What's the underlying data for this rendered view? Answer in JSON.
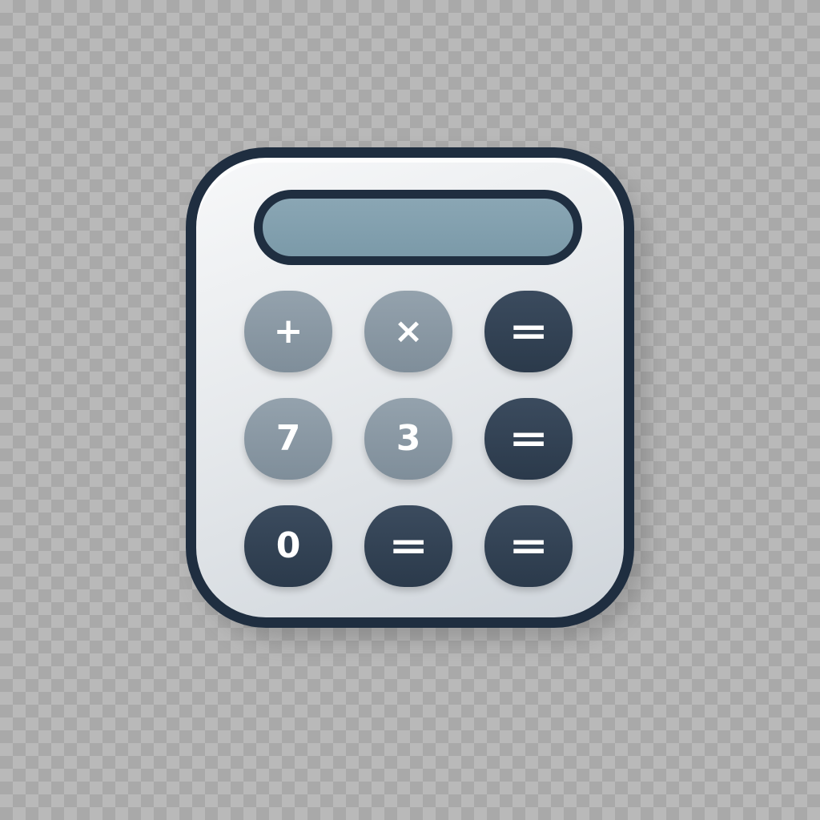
{
  "icon": {
    "name": "calculator-icon",
    "colors": {
      "outline": "#1f2e40",
      "body": "#e6e9ec",
      "display": "#7b9aa9",
      "light_key": "#8795a1",
      "dark_key": "#33435a",
      "key_text": "#ffffff",
      "background_checker_light": "#b9b9b9",
      "background_checker_dark": "#a9a9a9"
    },
    "keys": [
      {
        "label": "+",
        "tone": "light"
      },
      {
        "label": "×",
        "tone": "light"
      },
      {
        "label": "=",
        "tone": "dark"
      },
      {
        "label": "7",
        "tone": "light"
      },
      {
        "label": "3",
        "tone": "light"
      },
      {
        "label": "=",
        "tone": "dark"
      },
      {
        "label": "0",
        "tone": "dark"
      },
      {
        "label": "=",
        "tone": "dark"
      },
      {
        "label": "=",
        "tone": "dark"
      }
    ]
  }
}
